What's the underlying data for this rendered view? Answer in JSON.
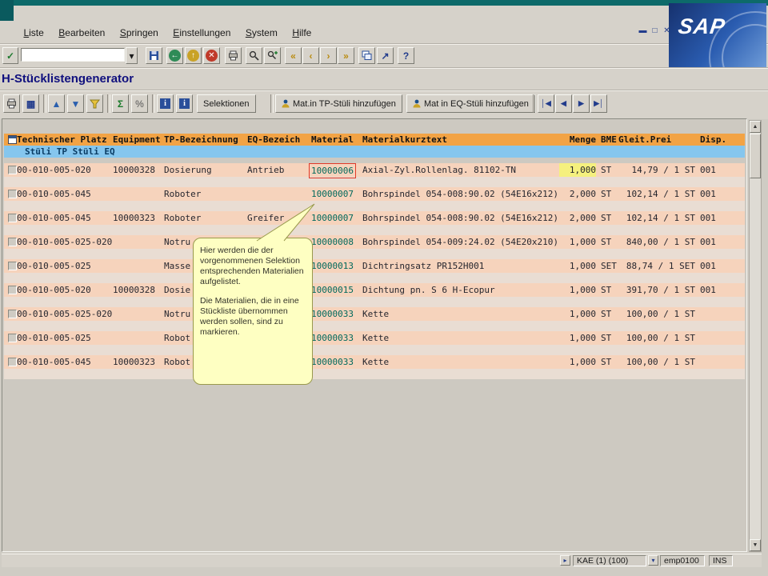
{
  "chrome": {
    "menu": [
      "Liste",
      "Bearbeiten",
      "Springen",
      "Einstellungen",
      "System",
      "Hilfe"
    ],
    "command_value": "",
    "title": "H-Stücklistengenerator",
    "logo_text": "SAP"
  },
  "icons": {
    "enter": "✓",
    "dropdown": "▾",
    "back": "←",
    "exit": "↑",
    "cancel": "✕",
    "first_page": "«",
    "prev_page": "‹",
    "next_page": "›",
    "last_page": "»",
    "shortcut": "↗",
    "help": "?",
    "grid": "▦",
    "sort_asc": "▲",
    "sort_desc": "▼",
    "sum": "Σ",
    "percent": "%",
    "info": "i",
    "nav_first": "│◀",
    "nav_prev": "◀",
    "nav_next": "▶",
    "nav_last": "▶│",
    "win_min": "▬",
    "win_restore": "□",
    "win_close": "✕",
    "scroll_up": "▲",
    "scroll_down": "▼",
    "status_list": "▸",
    "session_dropdown": "▾"
  },
  "app_toolbar": {
    "selektionen": "Selektionen",
    "mat_tp_button": "Mat.in TP-Stüli hinzufügen",
    "mat_eq_button": "Mat in EQ-Stüli hinzufügen"
  },
  "table": {
    "columns": [
      "Technischer Platz",
      "Equipment",
      "TP-Bezeichnung",
      "EQ-Bezeich",
      "Material",
      "Materialkurztext",
      "Menge",
      "BME",
      "Gleit.Prei",
      "Disp."
    ],
    "subheader": "Stüli TP Stüli EQ",
    "rows": [
      {
        "tp": "00-010-005-020",
        "eq": "10000328",
        "tpb": "Dosierung",
        "eqb": "Antrieb",
        "mat": "10000006",
        "text": "Axial-Zyl.Rollenlag. 81102-TN",
        "menge": "1,000",
        "bme": "ST",
        "preis": "14,79 / 1 ST",
        "disp": "001"
      },
      {
        "tp": "00-010-005-045",
        "eq": "",
        "tpb": "Roboter",
        "eqb": "",
        "mat": "10000007",
        "text": "Bohrspindel 054-008:90.02 (54E16x212)",
        "menge": "2,000",
        "bme": "ST",
        "preis": "102,14 / 1 ST",
        "disp": "001"
      },
      {
        "tp": "00-010-005-045",
        "eq": "10000323",
        "tpb": "Roboter",
        "eqb": "Greifer",
        "mat": "10000007",
        "text": "Bohrspindel 054-008:90.02 (54E16x212)",
        "menge": "2,000",
        "bme": "ST",
        "preis": "102,14 / 1 ST",
        "disp": "001"
      },
      {
        "tp": "00-010-005-025-020",
        "eq": "",
        "tpb": "Notru",
        "eqb": "",
        "mat": "10000008",
        "text": "Bohrspindel 054-009:24.02 (54E20x210)",
        "menge": "1,000",
        "bme": "ST",
        "preis": "840,00 / 1 ST",
        "disp": "001"
      },
      {
        "tp": "00-010-005-025",
        "eq": "",
        "tpb": "Masse",
        "eqb": "",
        "mat": "10000013",
        "text": "Dichtringsatz PR152H001",
        "menge": "1,000",
        "bme": "SET",
        "preis": "88,74 / 1 SET",
        "disp": "001"
      },
      {
        "tp": "00-010-005-020",
        "eq": "10000328",
        "tpb": "Dosie",
        "eqb": "",
        "mat": "10000015",
        "text": "Dichtung pn. S 6 H-Ecopur",
        "menge": "1,000",
        "bme": "ST",
        "preis": "391,70 / 1 ST",
        "disp": "001"
      },
      {
        "tp": "00-010-005-025-020",
        "eq": "",
        "tpb": "Notru",
        "eqb": "",
        "mat": "10000033",
        "text": "Kette",
        "menge": "1,000",
        "bme": "ST",
        "preis": "100,00 / 1 ST",
        "disp": ""
      },
      {
        "tp": "00-010-005-025",
        "eq": "",
        "tpb": "Robot",
        "eqb": "",
        "mat": "10000033",
        "text": "Kette",
        "menge": "1,000",
        "bme": "ST",
        "preis": "100,00 / 1 ST",
        "disp": ""
      },
      {
        "tp": "00-010-005-045",
        "eq": "10000323",
        "tpb": "Robot",
        "eqb": "",
        "mat": "10000033",
        "text": "Kette",
        "menge": "1,000",
        "bme": "ST",
        "preis": "100,00 / 1 ST",
        "disp": ""
      }
    ]
  },
  "tooltip": {
    "p1": "Hier werden die der vorgenommenen Selektion entsprechenden Materialien aufgelistet.",
    "p2": "Die Materialien, die in eine Stückliste übernommen werden sollen, sind zu markieren."
  },
  "statusbar": {
    "system": "KAE (1) (100)",
    "server": "emp0100",
    "mode": "INS"
  },
  "colors": {
    "header_orange": "#f2a345",
    "subheader_blue": "#85c6ee",
    "row_salmon": "#f6d3bc",
    "tooltip_yellow": "#feffc2",
    "material_teal": "#00695c",
    "selection_red": "#e03a2a",
    "menge_highlight": "#f5f07e"
  }
}
